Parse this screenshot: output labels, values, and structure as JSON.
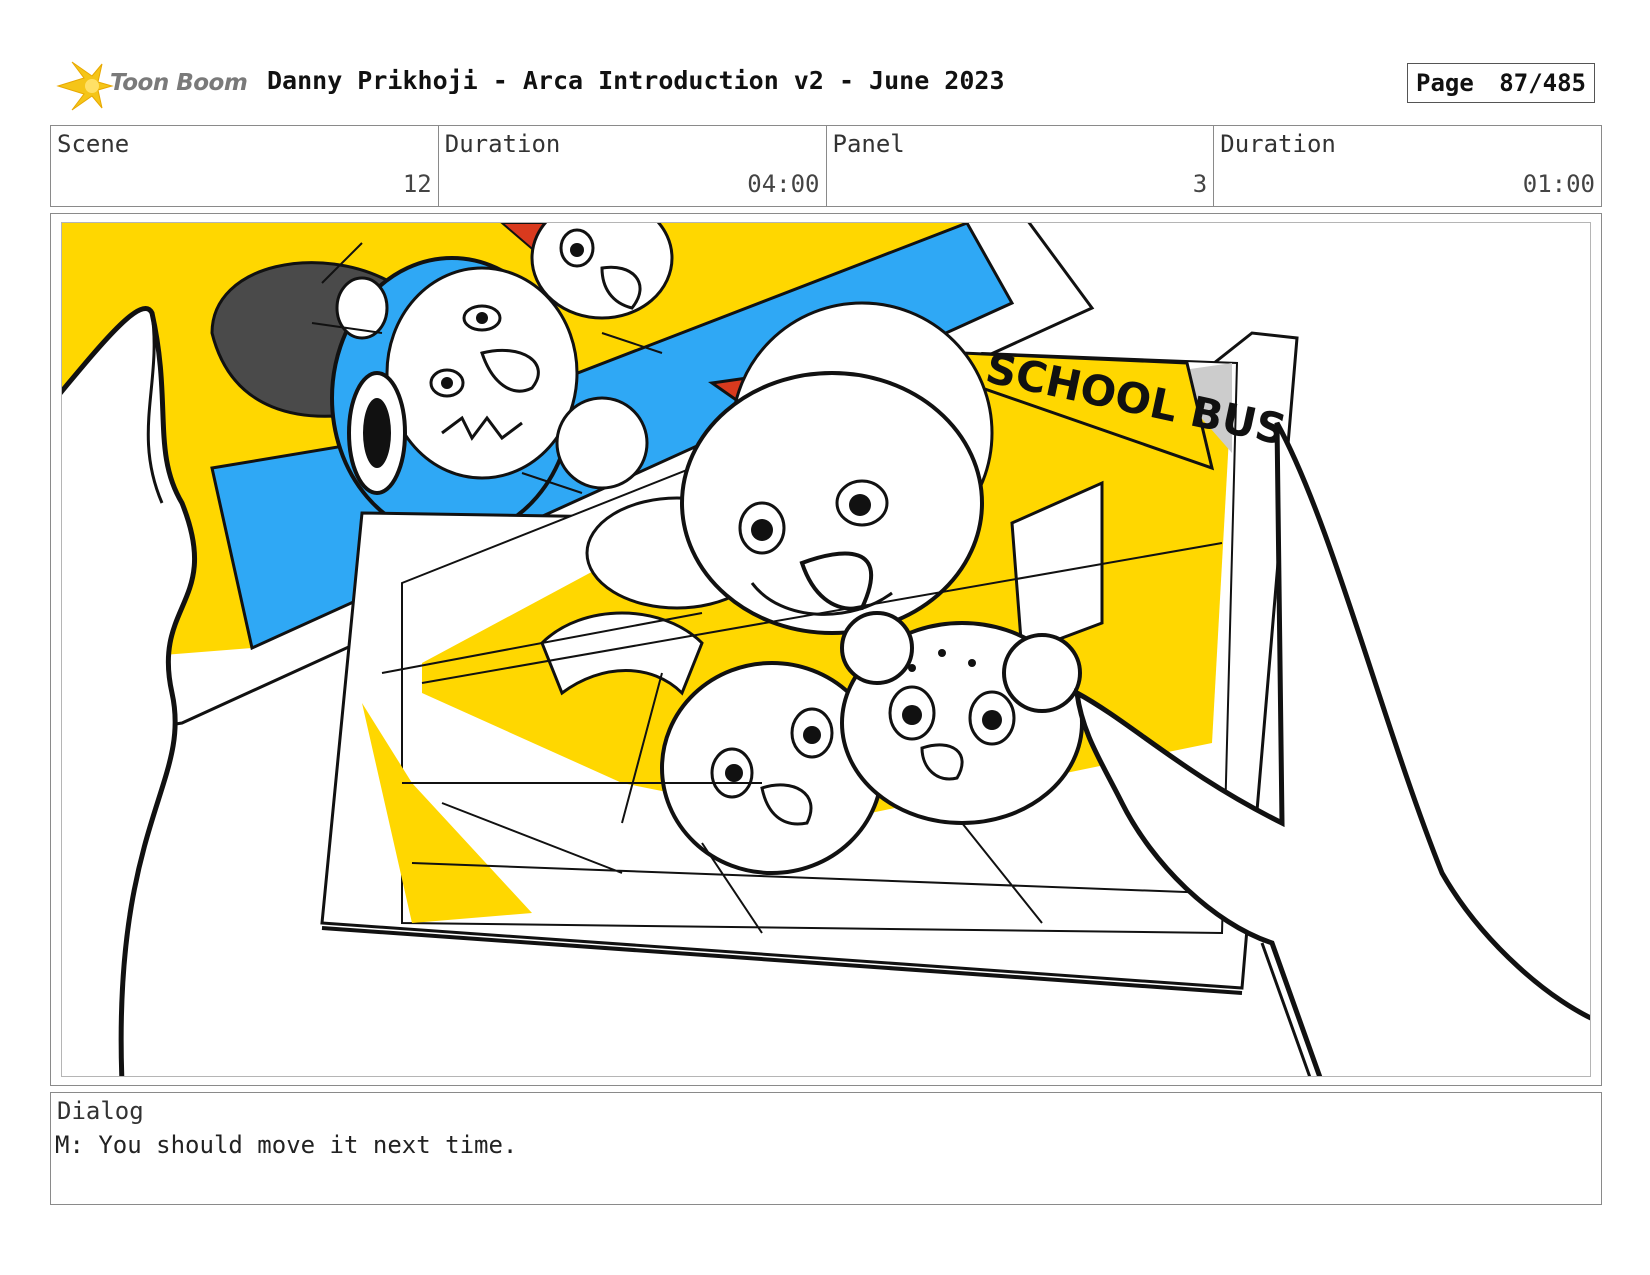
{
  "header": {
    "logo_text": "Toon Boom",
    "title": "Danny Prikhoji - Arca Introduction v2 - June 2023",
    "page_label": "Page",
    "page_number": "87/485"
  },
  "info": {
    "scene_label": "Scene",
    "scene_value": "12",
    "scene_duration_label": "Duration",
    "scene_duration_value": "04:00",
    "panel_label": "Panel",
    "panel_value": "3",
    "panel_duration_label": "Duration",
    "panel_duration_value": "01:00"
  },
  "artwork": {
    "sign_text": "SCHOOL BUS",
    "colors": {
      "yellow": "#FFD700",
      "blue": "#2FA8F5",
      "red": "#D93A1E",
      "dark_gray": "#4A4A4A",
      "line": "#111111"
    }
  },
  "dialog": {
    "label": "Dialog",
    "text": "M: You should move it next time."
  }
}
